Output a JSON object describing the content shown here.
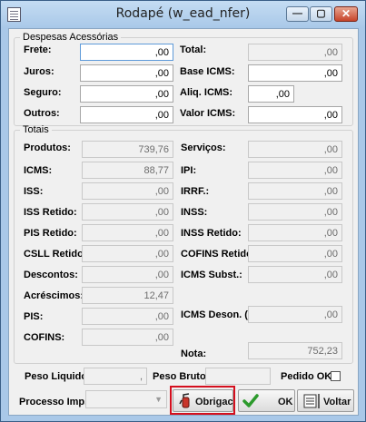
{
  "window": {
    "title": "Rodapé (w_ead_nfer)",
    "minimize": "—",
    "maximize": "▢",
    "close": "✕"
  },
  "despesas": {
    "legend": "Despesas Acessórias",
    "frete_label": "Frete:",
    "frete_value": ",00",
    "juros_label": "Juros:",
    "juros_value": ",00",
    "seguro_label": "Seguro:",
    "seguro_value": ",00",
    "outros_label": "Outros:",
    "outros_value": ",00",
    "total_label": "Total:",
    "total_value": ",00",
    "base_icms_label": "Base ICMS:",
    "base_icms_value": ",00",
    "aliq_icms_label": "Aliq. ICMS:",
    "aliq_icms_value": ",00",
    "valor_icms_label": "Valor ICMS:",
    "valor_icms_value": ",00"
  },
  "totais": {
    "legend": "Totais",
    "produtos_label": "Produtos:",
    "produtos_value": "739,76",
    "icms_label": "ICMS:",
    "icms_value": "88,77",
    "iss_label": "ISS:",
    "iss_value": ",00",
    "iss_retido_label": "ISS Retido:",
    "iss_retido_value": ",00",
    "pis_retido_label": "PIS Retido:",
    "pis_retido_value": ",00",
    "csll_retido_label": "CSLL Retido:",
    "csll_retido_value": ",00",
    "descontos_label": "Descontos:",
    "descontos_value": ",00",
    "acrescimos_label": "Acréscimos:",
    "acrescimos_value": "12,47",
    "pis_label": "PIS:",
    "pis_value": ",00",
    "cofins_label": "COFINS:",
    "cofins_value": ",00",
    "servicos_label": "Serviços:",
    "servicos_value": ",00",
    "ipi_label": "IPI:",
    "ipi_value": ",00",
    "irrf_label": "IRRF.:",
    "irrf_value": ",00",
    "inss_label": "INSS:",
    "inss_value": ",00",
    "inss_retido_label": "INSS Retido:",
    "inss_retido_value": ",00",
    "cofins_retido_label": "COFINS Retido:",
    "cofins_retido_value": ",00",
    "icms_subst_label": "ICMS Subst.:",
    "icms_subst_value": ",00",
    "icms_deson_label": "ICMS Deson. (-):",
    "icms_deson_value": ",00",
    "nota_label": "Nota:",
    "nota_value": "752,23"
  },
  "bottom": {
    "peso_liquido_label": "Peso Liquido:",
    "peso_liquido_value": ",",
    "peso_bruto_label": "Peso Bruto:",
    "peso_bruto_value": "",
    "pedido_ok_label": "Pedido OK",
    "processo_label": "Processo Imp.:",
    "processo_value": "",
    "obrigac_label": "Obrigac.",
    "ok_label": "OK",
    "voltar_label": "Voltar"
  },
  "colors": {
    "highlight": "#d40f1e",
    "ok_check": "#2c9a2c"
  }
}
